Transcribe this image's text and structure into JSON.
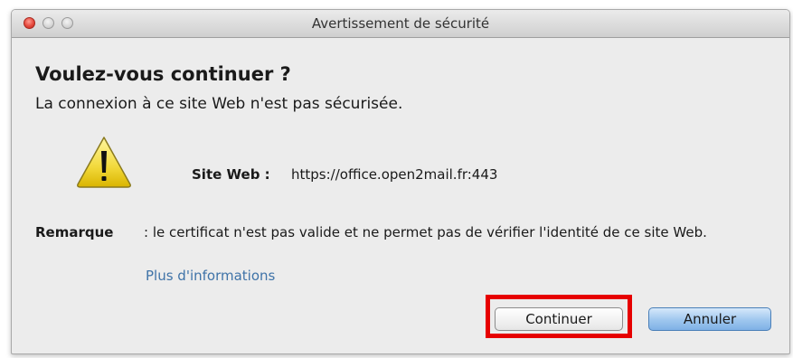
{
  "window": {
    "title": "Avertissement de sécurité"
  },
  "dialog": {
    "heading": "Voulez-vous continuer ?",
    "subheading": "La connexion à ce site Web n'est pas sécurisée.",
    "warning_icon": "warning-triangle-icon",
    "site_label": "Site Web :",
    "site_url": "https://office.open2mail.fr:443",
    "note_label": "Remarque",
    "note_text": ": le certificat n'est pas valide et ne permet pas de vérifier l'identité de ce site Web.",
    "more_info_link": "Plus d'informations"
  },
  "buttons": {
    "continue_label": "Continuer",
    "cancel_label": "Annuler"
  },
  "colors": {
    "highlight": "#e60000",
    "link": "#3f73a8",
    "default_button": "#9ec6ee"
  }
}
